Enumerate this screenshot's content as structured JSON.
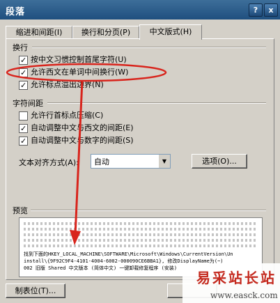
{
  "window": {
    "title": "段落",
    "help_glyph": "?",
    "close_glyph": "x"
  },
  "tabs": [
    {
      "label": "缩进和间距(I)",
      "active": false
    },
    {
      "label": "换行和分页(P)",
      "active": false
    },
    {
      "label": "中文版式(H)",
      "active": true
    }
  ],
  "line_break": {
    "group_title": "换行",
    "options": [
      {
        "label": "按中文习惯控制首尾字符(U)",
        "checked": true
      },
      {
        "label": "允许西文在单词中间换行(W)",
        "checked": true
      },
      {
        "label": "允许标点溢出边界(N)",
        "checked": true
      }
    ]
  },
  "spacing": {
    "group_title": "字符间距",
    "options": [
      {
        "label": "允许行首标点压缩(C)",
        "checked": false
      },
      {
        "label": "自动调整中文与西文的间距(E)",
        "checked": true
      },
      {
        "label": "自动调整中文与数字的间距(S)",
        "checked": true
      }
    ]
  },
  "alignment": {
    "label": "文本对齐方式(A):",
    "value": "自动",
    "options_button": "选项(O)..."
  },
  "preview": {
    "title": "预览",
    "text_lines": [
      "找到下面的HKEY_LOCAL_MACHINE\\SOFTWARE\\Microsoft\\Windows\\CurrentVersion\\Un",
      "install\\{9F92C9F4-4101-4004-6002-000090CE6BBA1}, 修改DisplayName为(~)",
      "002 旧版 Shared 中文版本 (简体中文) 一键卸载修复程序 (安装)"
    ]
  },
  "footer": {
    "tabs_button": "制表位(T)...",
    "ok_button": ""
  },
  "watermark": {
    "text": "易采站长站",
    "url": "www.easck.com"
  },
  "colors": {
    "accent": "#1f4f7f",
    "highlight_ellipse": "#d8241c",
    "watermark": "#c42a1f"
  }
}
